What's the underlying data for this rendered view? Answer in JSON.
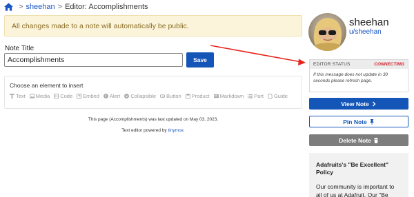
{
  "breadcrumb": {
    "home_icon": "home-icon",
    "user_link": "sheehan",
    "current": "Editor: Accomplishments",
    "separator": ">"
  },
  "alert": {
    "text": "All changes made to a note will automatically be public."
  },
  "form": {
    "title_label": "Note Title",
    "title_value": "Accomplishments",
    "save_label": "Save"
  },
  "insert": {
    "heading": "Choose an element to insert",
    "items": [
      {
        "label": "Text",
        "icon": "text-icon"
      },
      {
        "label": "Media",
        "icon": "media-icon"
      },
      {
        "label": "Code",
        "icon": "code-icon"
      },
      {
        "label": "Embed",
        "icon": "embed-icon"
      },
      {
        "label": "Alert",
        "icon": "alert-icon"
      },
      {
        "label": "Collapsible",
        "icon": "collapsible-icon"
      },
      {
        "label": "Button",
        "icon": "button-icon"
      },
      {
        "label": "Product",
        "icon": "product-icon"
      },
      {
        "label": "Markdown",
        "icon": "markdown-icon"
      },
      {
        "label": "Part",
        "icon": "part-icon"
      },
      {
        "label": "Guide",
        "icon": "guide-icon"
      }
    ]
  },
  "footer": {
    "updated": "This page (Accomplishments) was last updated on May 03, 2023.",
    "powered_prefix": "Text editor powered by",
    "powered_link": "tinymce."
  },
  "profile": {
    "name": "sheehan",
    "handle": "u/sheehan"
  },
  "status": {
    "label": "EDITOR STATUS",
    "state": "CONNECTING",
    "message": "If this message does not update in 30 seconds please refresh page."
  },
  "actions": {
    "view_label": "View Note",
    "pin_label": "Pin Note",
    "delete_label": "Delete Note"
  },
  "policy": {
    "title": "Adafruits's \"Be Excellent\" Policy",
    "text": "Our community is important to all of us at Adafruit. Our \"Be"
  },
  "colors": {
    "primary": "#1356b8",
    "alert_bg": "#fbf4da",
    "alert_text": "#8a6d24",
    "status_red": "#d0202a",
    "arrow_red": "#e8251c"
  }
}
